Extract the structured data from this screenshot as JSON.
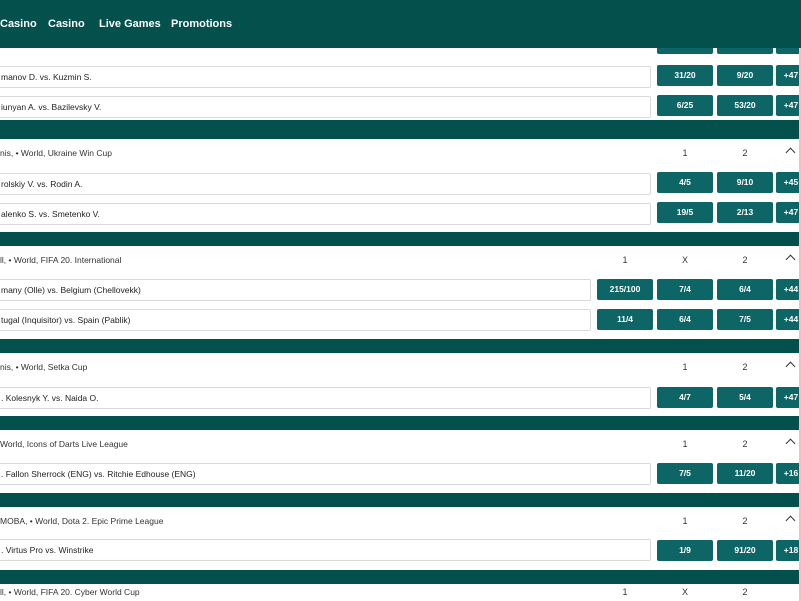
{
  "nav": {
    "items": [
      "Casino",
      "Casino",
      "Live Games",
      "Promotions"
    ]
  },
  "sections": [
    {
      "title": "",
      "columns": [],
      "matches": [
        {
          "teams": "manov D. vs. Kuzmin S.",
          "odds": [
            "31/20",
            "9/20"
          ],
          "more": "+47"
        },
        {
          "teams": "iunyan A. vs. Bazilevsky V.",
          "odds": [
            "6/25",
            "53/20"
          ],
          "more": "+47"
        }
      ]
    },
    {
      "title": "nis, • World, Ukraine Win Cup",
      "columns": [
        "1",
        "2"
      ],
      "matches": [
        {
          "teams": "rolskiy V. vs. Rodin A.",
          "odds": [
            "4/5",
            "9/10"
          ],
          "more": "+45"
        },
        {
          "teams": "alenko S. vs. Smetenko V.",
          "odds": [
            "19/5",
            "2/13"
          ],
          "more": "+47"
        }
      ]
    },
    {
      "title": "ll, • World, FIFA 20. International",
      "columns": [
        "1",
        "X",
        "2"
      ],
      "matches": [
        {
          "teams": "many (Olle) vs. Belgium (Chellovekk)",
          "odds": [
            "215/100",
            "7/4",
            "6/4"
          ],
          "more": "+44"
        },
        {
          "teams": "tugal (Inquisitor) vs. Spain (Pablik)",
          "odds": [
            "11/4",
            "6/4",
            "7/5"
          ],
          "more": "+44"
        }
      ]
    },
    {
      "title": "nis, • World, Setka Cup",
      "columns": [
        "1",
        "2"
      ],
      "matches": [
        {
          "teams": ". Kolesnyk Y. vs. Naida O.",
          "odds": [
            "4/7",
            "5/4"
          ],
          "more": "+47"
        }
      ]
    },
    {
      "title": "World, Icons of Darts Live League",
      "columns": [
        "1",
        "2"
      ],
      "matches": [
        {
          "teams": ". Fallon Sherrock (ENG) vs. Ritchie Edhouse (ENG)",
          "odds": [
            "7/5",
            "11/20"
          ],
          "more": "+16"
        }
      ]
    },
    {
      "title": "MOBA, • World, Dota 2. Epic Prime League",
      "columns": [
        "1",
        "2"
      ],
      "matches": [
        {
          "teams": ". Virtus Pro vs. Winstrike",
          "odds": [
            "1/9",
            "91/20"
          ],
          "more": "+18"
        }
      ]
    },
    {
      "title": "ll, • World, FIFA 20. Cyber World Cup",
      "columns": [
        "1",
        "X",
        "2"
      ],
      "matches": []
    }
  ]
}
